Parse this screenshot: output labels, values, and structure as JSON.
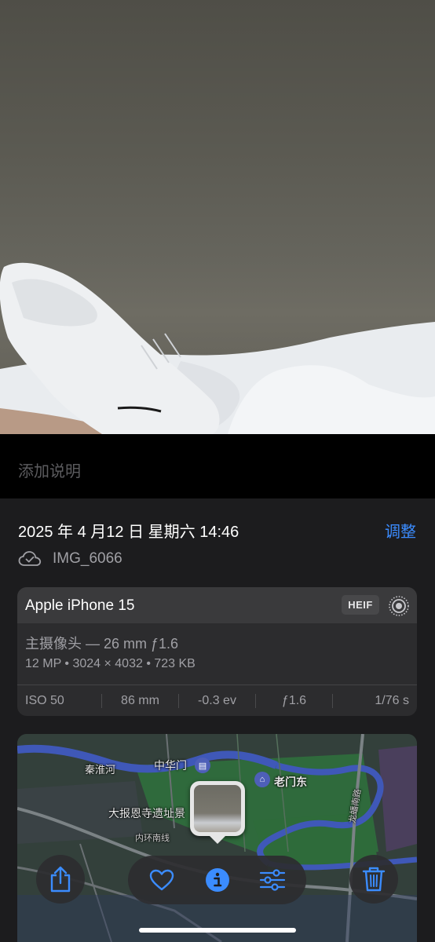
{
  "caption": {
    "placeholder": "添加说明"
  },
  "info": {
    "date_time": "2025 年 4 月12 日 星期六 14:46",
    "adjust_label": "调整",
    "file_name": "IMG_6066"
  },
  "camera": {
    "model": "Apple iPhone 15",
    "format_badge": "HEIF",
    "lens": "主摄像头 — 26 mm ƒ1.6",
    "specs": "12 MP • 3024 × 4032 • 723 KB",
    "exif": {
      "iso": "ISO 50",
      "focal_length": "86 mm",
      "exposure_bias": "-0.3 ev",
      "aperture": "ƒ1.6",
      "shutter": "1/76 s"
    }
  },
  "map": {
    "labels": {
      "river": "秦淮河",
      "zhonghuamen": "中华门",
      "laomendong": "老门东",
      "temple_site": "大报恩寺遗址景",
      "ring_road": "内环南线",
      "longpan_road": "龙蟠南路"
    }
  },
  "toolbar": {
    "share_icon": "share-icon",
    "favorite_icon": "heart-icon",
    "info_icon": "info-icon",
    "adjust_icon": "sliders-icon",
    "delete_icon": "trash-icon",
    "accent": "#3b8cff"
  }
}
